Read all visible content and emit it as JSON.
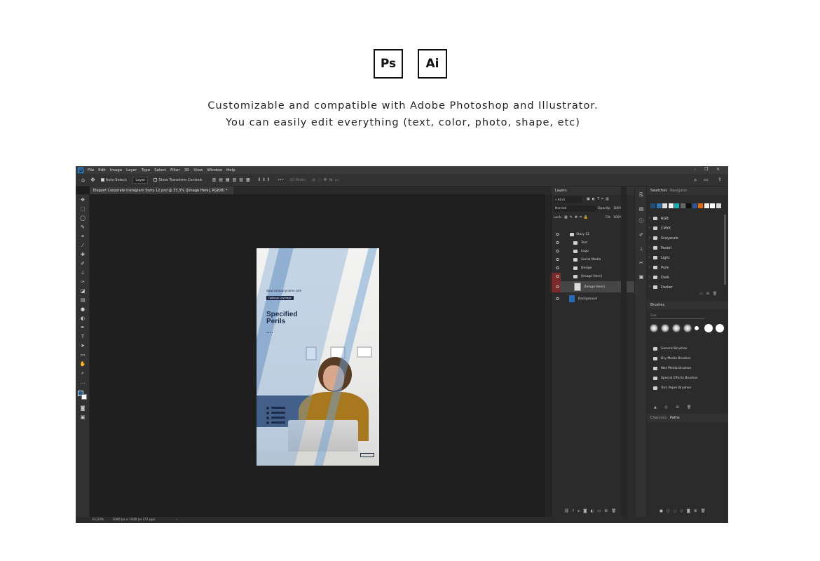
{
  "badges": {
    "ps": "Ps",
    "ai": "Ai"
  },
  "tagline": {
    "line1": "Customizable and compatible with Adobe Photoshop and Illustrator.",
    "line2": "You can easily edit everything (text, color, photo, shape, etc)"
  },
  "photoshop": {
    "logo": "Ps",
    "menu": [
      "File",
      "Edit",
      "Image",
      "Layer",
      "Type",
      "Select",
      "Filter",
      "3D",
      "View",
      "Window",
      "Help"
    ],
    "options": {
      "auto_select": "Auto-Select:",
      "layer_value": "Layer",
      "show_transform": "Show Transform Controls",
      "mode_3d": "3D Mode:",
      "more": "•••"
    },
    "document_tab": "Elegant Corporate Instagram Story 12.psd @ 33,3% ([Image Here], RGB/8) *",
    "status": {
      "zoom": "33,33%",
      "size": "1080 px x 1920 px (72 ppi)"
    },
    "document": {
      "url_text": "www.companyname.com",
      "badge": "Optional Coverage",
      "title_line1": "Specified",
      "title_line2": "Perils",
      "dots": "••••"
    },
    "layers_panel": {
      "tab": "Layers",
      "kind": "Kind",
      "blend_mode": "Normal",
      "opacity_label": "Opacity:",
      "opacity_value": "100%",
      "lock_label": "Lock:",
      "fill_label": "Fill:",
      "fill_value": "100%",
      "layers": [
        {
          "name": "Story 12",
          "type": "group-open"
        },
        {
          "name": "Text",
          "type": "group"
        },
        {
          "name": "Logo",
          "type": "group"
        },
        {
          "name": "Social Media",
          "type": "group"
        },
        {
          "name": "Design",
          "type": "group"
        },
        {
          "name": "[Image Here]",
          "type": "group-open"
        },
        {
          "name": "[Image Here]",
          "type": "smart-object"
        },
        {
          "name": "Background",
          "type": "fill"
        }
      ]
    },
    "swatches_panel": {
      "tabs": [
        "Swatches",
        "Navigator"
      ],
      "colors": [
        "#1f4e79",
        "#2e75b6",
        "#dddddd",
        "#f2f2f2",
        "#1bb0b0",
        "#666666",
        "#111111",
        "#2f5597",
        "#e36c0a",
        "#f2f2f2",
        "#ffffff",
        "#d9d9d9"
      ],
      "groups": [
        "RGB",
        "CMYK",
        "Grayscale",
        "Pastel",
        "Light",
        "Pure",
        "Dark",
        "Darker"
      ]
    },
    "brushes_panel": {
      "tab": "Brushes",
      "size_label": "Size:",
      "groups": [
        "General Brushes",
        "Dry Media Brushes",
        "Wet Media Brushes",
        "Special Effects Brushes",
        "Torn Paper Brushes"
      ]
    },
    "channels_panel": {
      "tabs": [
        "Channels",
        "Paths"
      ]
    }
  }
}
